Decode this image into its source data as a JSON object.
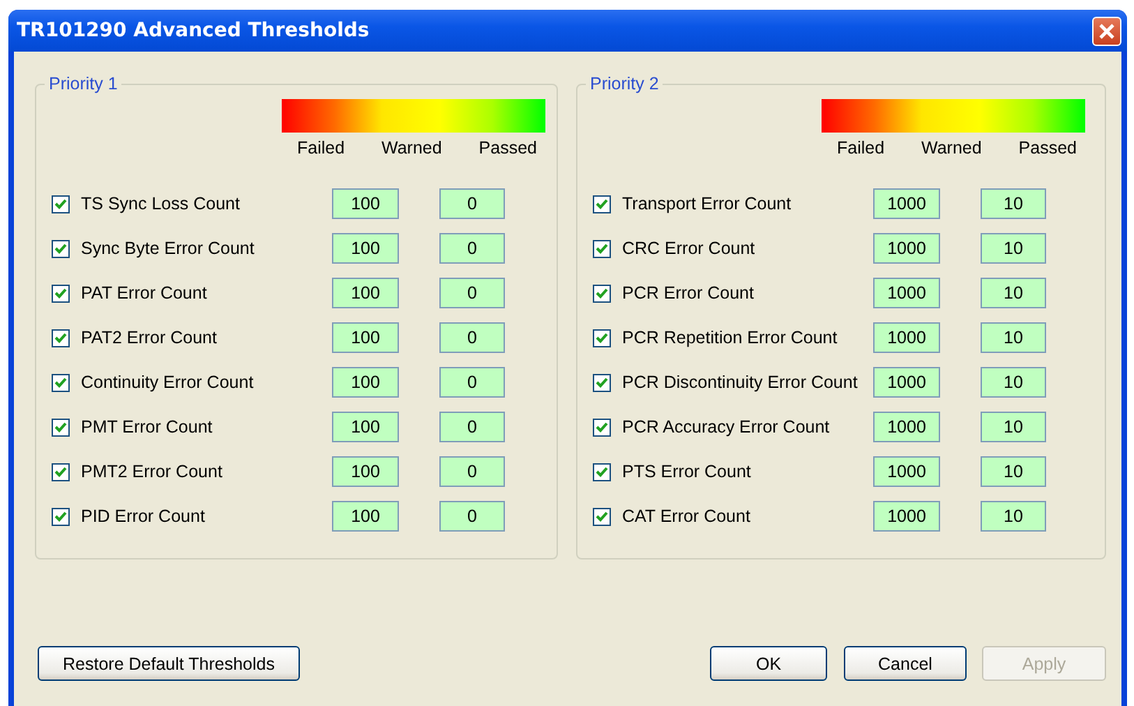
{
  "window": {
    "title": "TR101290 Advanced Thresholds"
  },
  "groups": [
    {
      "legend": "Priority 1",
      "scale": [
        "Failed",
        "Warned",
        "Passed"
      ],
      "rows": [
        {
          "label": "TS Sync Loss Count",
          "checked": true,
          "value_1": "100",
          "value_2": "0"
        },
        {
          "label": "Sync Byte Error Count",
          "checked": true,
          "value_1": "100",
          "value_2": "0"
        },
        {
          "label": "PAT Error Count",
          "checked": true,
          "value_1": "100",
          "value_2": "0"
        },
        {
          "label": "PAT2 Error Count",
          "checked": true,
          "value_1": "100",
          "value_2": "0"
        },
        {
          "label": "Continuity Error Count",
          "checked": true,
          "value_1": "100",
          "value_2": "0"
        },
        {
          "label": "PMT Error Count",
          "checked": true,
          "value_1": "100",
          "value_2": "0"
        },
        {
          "label": "PMT2 Error Count",
          "checked": true,
          "value_1": "100",
          "value_2": "0"
        },
        {
          "label": "PID Error Count",
          "checked": true,
          "value_1": "100",
          "value_2": "0"
        }
      ]
    },
    {
      "legend": "Priority 2",
      "scale": [
        "Failed",
        "Warned",
        "Passed"
      ],
      "rows": [
        {
          "label": "Transport Error Count",
          "checked": true,
          "value_1": "1000",
          "value_2": "10"
        },
        {
          "label": "CRC Error Count",
          "checked": true,
          "value_1": "1000",
          "value_2": "10"
        },
        {
          "label": "PCR Error Count",
          "checked": true,
          "value_1": "1000",
          "value_2": "10"
        },
        {
          "label": "PCR Repetition Error Count",
          "checked": true,
          "value_1": "1000",
          "value_2": "10"
        },
        {
          "label": "PCR Discontinuity Error Count",
          "checked": true,
          "value_1": "1000",
          "value_2": "10"
        },
        {
          "label": "PCR Accuracy Error Count",
          "checked": true,
          "value_1": "1000",
          "value_2": "10"
        },
        {
          "label": "PTS Error Count",
          "checked": true,
          "value_1": "1000",
          "value_2": "10"
        },
        {
          "label": "CAT Error Count",
          "checked": true,
          "value_1": "1000",
          "value_2": "10"
        }
      ]
    }
  ],
  "buttons": [
    {
      "label": "Restore Default Thresholds",
      "kind": "left",
      "disabled": false
    },
    {
      "label": "OK",
      "kind": "right",
      "disabled": false
    },
    {
      "label": "Cancel",
      "kind": "right",
      "disabled": false
    },
    {
      "label": "Apply",
      "kind": "right",
      "disabled": true
    }
  ]
}
